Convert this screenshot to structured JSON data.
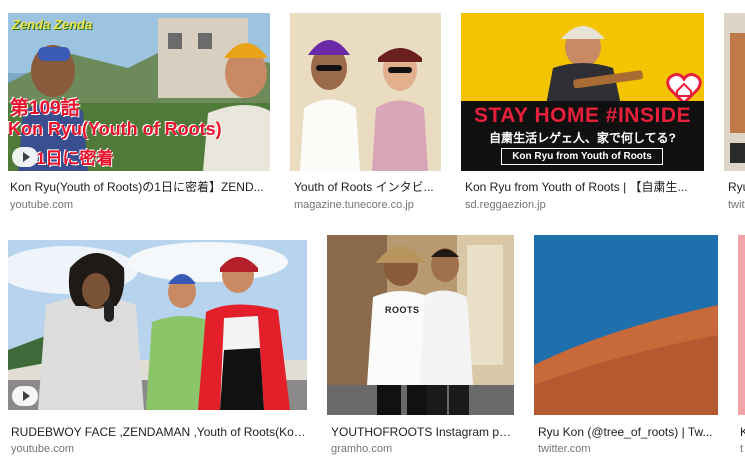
{
  "results": [
    {
      "caption": "Kon Ryu(Youth of Roots)の1日に密着】ZEND...",
      "source": "youtube.com",
      "is_video": true,
      "overlay": {
        "logo": "Zenda Zenda",
        "line1": "第109話",
        "line2": "Kon Ryu(Youth of Roots)",
        "line3": "1日に密着"
      }
    },
    {
      "caption": "Youth of Roots インタビ...",
      "source": "magazine.tunecore.co.jp"
    },
    {
      "caption": "Kon Ryu from Youth of Roots | 【自粛生...",
      "source": "sd.reggaezion.jp",
      "overlay": {
        "headline": "STAY HOME #INSIDE",
        "subhead": "自粛生活レゲェ人、家で何してる?",
        "name_box": "Kon Ryu from Youth of Roots"
      }
    },
    {
      "caption": "Ryu",
      "source": "twit"
    },
    {
      "caption": "RUDEBWOY FACE ,ZENDAMAN ,Youth of Roots(Kon...",
      "source": "youtube.com",
      "is_video": true
    },
    {
      "caption": "YOUTHOFROOTS Instagram po...",
      "source": "gramho.com",
      "overlay": {
        "shirt_text": "ROOTS"
      }
    },
    {
      "caption": "Ryu Kon (@tree_of_roots) | Tw...",
      "source": "twitter.com"
    },
    {
      "caption": "K",
      "source": "t"
    }
  ],
  "colors": {
    "caption": "#202124",
    "source": "#70757a",
    "stay_home_bg": "#f5c400",
    "twitter_blue": "#1f6fad",
    "sand": "#c8693a"
  }
}
